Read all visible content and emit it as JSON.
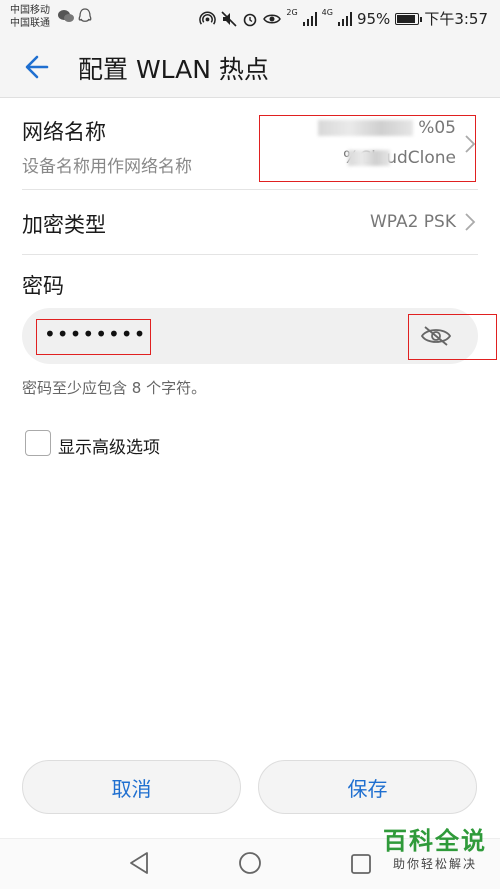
{
  "status_bar": {
    "carrier_1": "中国移动",
    "carrier_2": "中国联通",
    "battery": "95%",
    "time": "下午3:57",
    "net_1": "2G",
    "net_2": "4G",
    "battery_level": 0.95
  },
  "header": {
    "title": "配置 WLAN 热点"
  },
  "network_name": {
    "label": "网络名称",
    "subtitle": "设备名称用作网络名称",
    "value_line_1": "%05",
    "value_line_2": "%CloudClone"
  },
  "encryption": {
    "label": "加密类型",
    "value": "WPA2 PSK"
  },
  "password": {
    "label": "密码",
    "masked_value": "••••••••",
    "hint": "密码至少应包含 8 个字符。"
  },
  "advanced": {
    "label": "显示高级选项",
    "checked": false
  },
  "buttons": {
    "cancel": "取消",
    "save": "保存"
  },
  "watermark": {
    "big": "百科全说",
    "small": "助你轻松解决"
  },
  "colors": {
    "accent": "#1f6fd0",
    "highlight_box": "#e02020",
    "watermark_green": "#2f9a3a"
  }
}
